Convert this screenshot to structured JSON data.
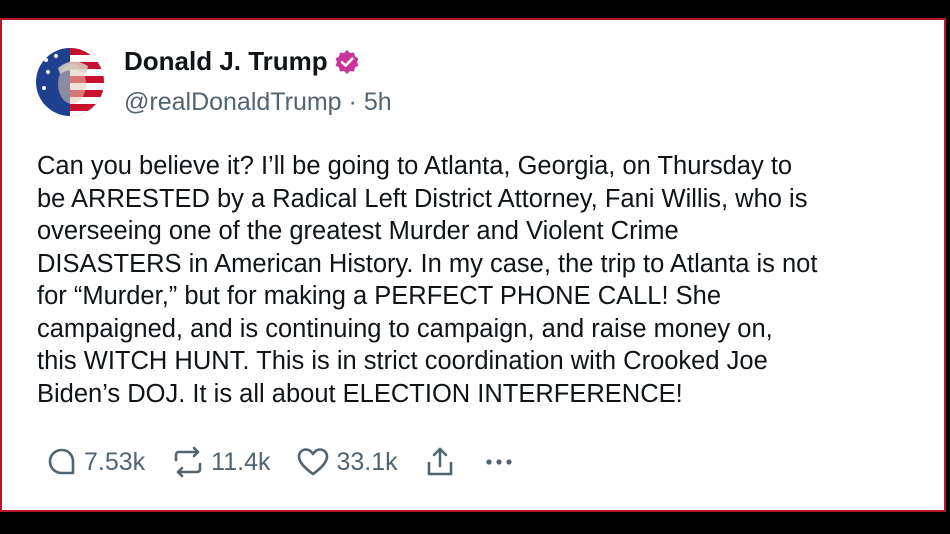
{
  "author": {
    "display_name": "Donald J. Trump",
    "handle": "@realDonaldTrump",
    "separator": "·",
    "time_ago": "5h",
    "verified_color": "#c9359c"
  },
  "post": {
    "lines": [
      "Can you believe it? I’ll be going to Atlanta, Georgia, on Thursday to",
      "be ARRESTED by a Radical Left District Attorney, Fani Willis, who is",
      "overseeing one of the greatest Murder and Violent Crime",
      "DISASTERS in American History. In my case, the trip to Atlanta is not",
      "for “Murder,” but for making a PERFECT PHONE CALL! She",
      "campaigned, and is continuing to campaign, and raise money on,",
      "this WITCH HUNT. This is in strict coordination with Crooked Joe",
      "Biden’s DOJ. It is all about ELECTION INTERFERENCE!"
    ]
  },
  "actions": {
    "replies": "7.53k",
    "retruths": "11.4k",
    "likes": "33.1k",
    "icons": [
      "reply-icon",
      "retruth-icon",
      "like-icon",
      "share-icon",
      "more-icon"
    ]
  },
  "colors": {
    "border": "#b3192b",
    "text": "#0f1419",
    "muted": "#536471"
  }
}
